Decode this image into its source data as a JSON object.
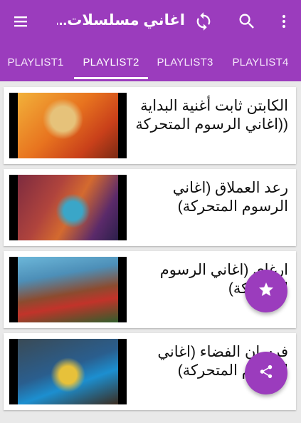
{
  "app": {
    "title": "اغاني مسلسلات...",
    "accent_color": "#9b3cbd"
  },
  "toolbar": {
    "icons": [
      "menu-icon",
      "refresh-icon",
      "search-icon",
      "more-vert-icon"
    ]
  },
  "tabs": [
    {
      "label": "PLAYLIST1",
      "active": false
    },
    {
      "label": "PLAYLIST2",
      "active": true
    },
    {
      "label": "PLAYLIST3",
      "active": false
    },
    {
      "label": "PLAYLIST4",
      "active": false
    }
  ],
  "videos": [
    {
      "title": "الكابتن ثابت  أغنية البداية ((اغاني الرسوم المتحركة"
    },
    {
      "title": "رعد العملاق (اغاني الرسوم المتحركة)"
    },
    {
      "title": "ارغاي (اغاني الرسوم المتحركة)"
    },
    {
      "title": "فرسان الفضاء (اغاني الرسوم المتحركة)"
    }
  ],
  "fabs": {
    "favorite_icon": "star-icon",
    "share_icon": "share-icon"
  }
}
